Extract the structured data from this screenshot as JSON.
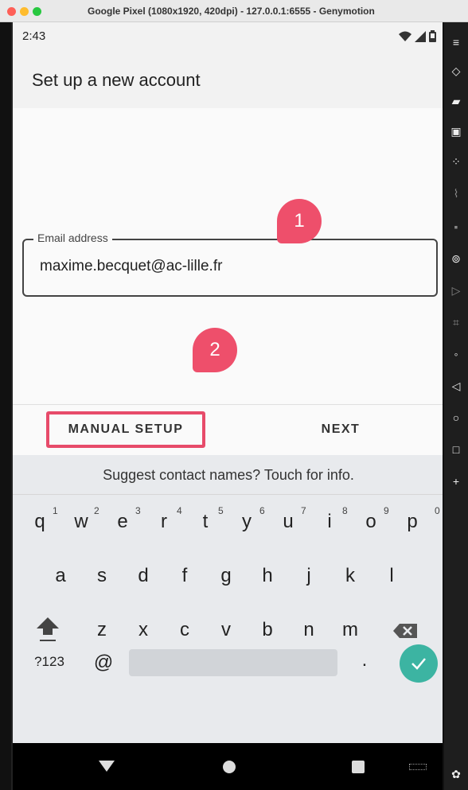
{
  "window": {
    "title": "Google Pixel (1080x1920, 420dpi) - 127.0.0.1:6555 - Genymotion"
  },
  "status_bar": {
    "time": "2:43"
  },
  "app_bar": {
    "title": "Set up a new account"
  },
  "email_field": {
    "label": "Email address",
    "value": "maxime.becquet@ac-lille.fr"
  },
  "annotations": {
    "bubble_1": "1",
    "bubble_2": "2"
  },
  "actions": {
    "manual_setup": "MANUAL SETUP",
    "next": "NEXT"
  },
  "keyboard": {
    "suggestion": "Suggest contact names? Touch for info.",
    "row1": [
      "q",
      "w",
      "e",
      "r",
      "t",
      "y",
      "u",
      "i",
      "o",
      "p"
    ],
    "row1_hints": [
      "1",
      "2",
      "3",
      "4",
      "5",
      "6",
      "7",
      "8",
      "9",
      "0"
    ],
    "row2": [
      "a",
      "s",
      "d",
      "f",
      "g",
      "h",
      "j",
      "k",
      "l"
    ],
    "row3": [
      "z",
      "x",
      "c",
      "v",
      "b",
      "n",
      "m"
    ],
    "symbols_key": "?123",
    "at_key": "@",
    "period_key": "."
  },
  "colors": {
    "accent_annotation": "#ee4f6b",
    "enter_key": "#3cb4a2"
  }
}
